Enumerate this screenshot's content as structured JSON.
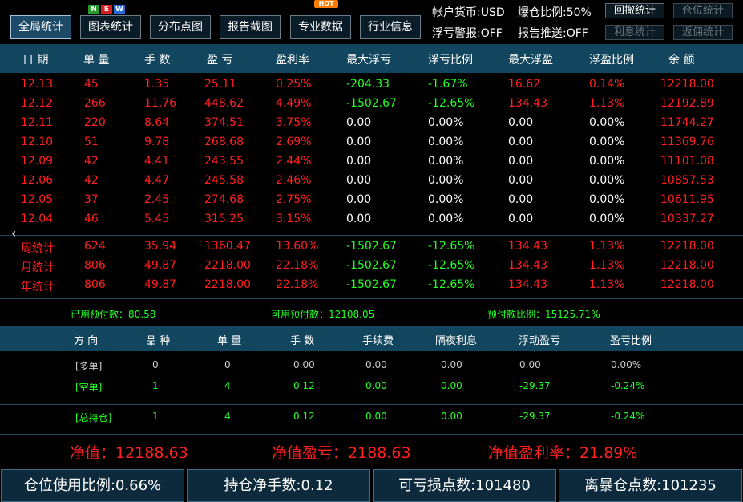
{
  "toolbar": {
    "buttons": [
      "全局统计",
      "图表统计",
      "分布点图",
      "报告截图",
      "专业数据",
      "行业信息"
    ],
    "new_badge": [
      "N",
      "E",
      "W"
    ],
    "hot_badge": "HOT"
  },
  "account": {
    "currency": "帐户货币:USD",
    "burst_ratio": "爆仓比例:50%",
    "float_alert": "浮亏警报:OFF",
    "report_push": "报告推送:OFF",
    "btn_drawdown": "回撤统计",
    "btn_position": "仓位统计",
    "btn_interest": "利息统计",
    "btn_rebate": "返佣统计"
  },
  "stats_table": {
    "headers": [
      "日 期",
      "单 量",
      "手 数",
      "盈 亏",
      "盈利率",
      "最大浮亏",
      "浮亏比例",
      "最大浮盈",
      "浮盈比例",
      "余 额"
    ],
    "rows": [
      [
        "12.13",
        "45",
        "1.35",
        "25.11",
        "0.25%",
        "-204.33",
        "-1.67%",
        "16.62",
        "0.14%",
        "12218.00"
      ],
      [
        "12.12",
        "266",
        "11.76",
        "448.62",
        "4.49%",
        "-1502.67",
        "-12.65%",
        "134.43",
        "1.13%",
        "12192.89"
      ],
      [
        "12.11",
        "220",
        "8.64",
        "374.51",
        "3.75%",
        "0.00",
        "0.00%",
        "0.00",
        "0.00%",
        "11744.27"
      ],
      [
        "12.10",
        "51",
        "9.78",
        "268.68",
        "2.69%",
        "0.00",
        "0.00%",
        "0.00",
        "0.00%",
        "11369.76"
      ],
      [
        "12.09",
        "42",
        "4.41",
        "243.55",
        "2.44%",
        "0.00",
        "0.00%",
        "0.00",
        "0.00%",
        "11101.08"
      ],
      [
        "12.06",
        "42",
        "4.47",
        "245.58",
        "2.46%",
        "0.00",
        "0.00%",
        "0.00",
        "0.00%",
        "10857.53"
      ],
      [
        "12.05",
        "37",
        "2.45",
        "274.68",
        "2.75%",
        "0.00",
        "0.00%",
        "0.00",
        "0.00%",
        "10611.95"
      ],
      [
        "12.04",
        "46",
        "5.45",
        "315.25",
        "3.15%",
        "0.00",
        "0.00%",
        "0.00",
        "0.00%",
        "10337.27"
      ]
    ],
    "totals": [
      [
        "周统计",
        "624",
        "35.94",
        "1360.47",
        "13.60%",
        "-1502.67",
        "-12.65%",
        "134.43",
        "1.13%",
        "12218.00"
      ],
      [
        "月统计",
        "806",
        "49.87",
        "2218.00",
        "22.18%",
        "-1502.67",
        "-12.65%",
        "134.43",
        "1.13%",
        "12218.00"
      ],
      [
        "年统计",
        "806",
        "49.87",
        "2218.00",
        "22.18%",
        "-1502.67",
        "-12.65%",
        "134.43",
        "1.13%",
        "12218.00"
      ]
    ]
  },
  "margin": {
    "used": "已用预付款：80.58",
    "available": "可用预付款：12108.05",
    "ratio": "预付款比例：15125.71%"
  },
  "positions": {
    "headers": [
      "方 向",
      "品 种",
      "单 量",
      "手 数",
      "手续费",
      "隔夜利息",
      "浮动盈亏",
      "盈亏比例"
    ],
    "rows": [
      [
        "[多单]",
        "0",
        "0",
        "0.00",
        "0.00",
        "0.00",
        "0.00",
        "0.00%"
      ],
      [
        "[空单]",
        "1",
        "4",
        "0.12",
        "0.00",
        "0.00",
        "-29.37",
        "-0.24%"
      ],
      [
        "[总持仓]",
        "1",
        "4",
        "0.12",
        "0.00",
        "0.00",
        "-29.37",
        "-0.24%"
      ]
    ]
  },
  "net": {
    "value": "净值：12188.63",
    "profit": "净值盈亏：2188.63",
    "rate": "净值盈利率：21.89%"
  },
  "footer": {
    "usage": "仓位使用比例:0.66%",
    "net_lots": "持仓净手数:0.12",
    "loss_points": "可亏损点数:101480",
    "burst_points": "离暴仓点数:101235"
  },
  "nav_icon": "chevron-left-icon",
  "colors": {
    "header_bg": "#12455e",
    "profit": "#ff2020",
    "loss": "#22ff22"
  }
}
